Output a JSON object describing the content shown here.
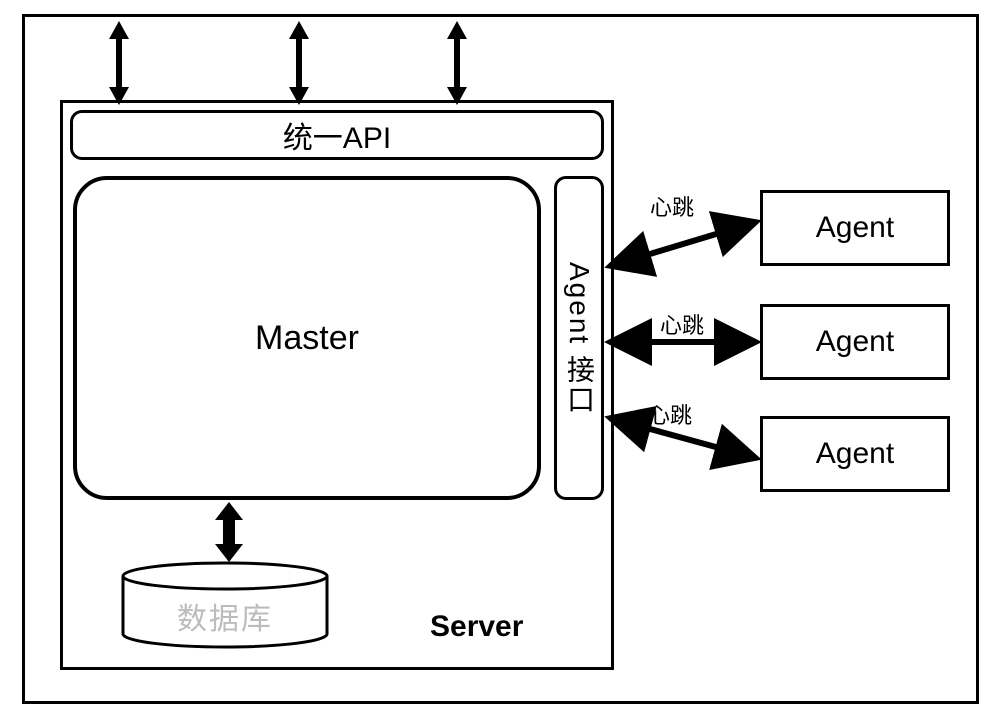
{
  "labels": {
    "unified_api": "统一API",
    "master": "Master",
    "agent_interface": "Agent 接口",
    "database": "数据库",
    "server": "Server",
    "heartbeat": "心跳",
    "agent": "Agent"
  }
}
